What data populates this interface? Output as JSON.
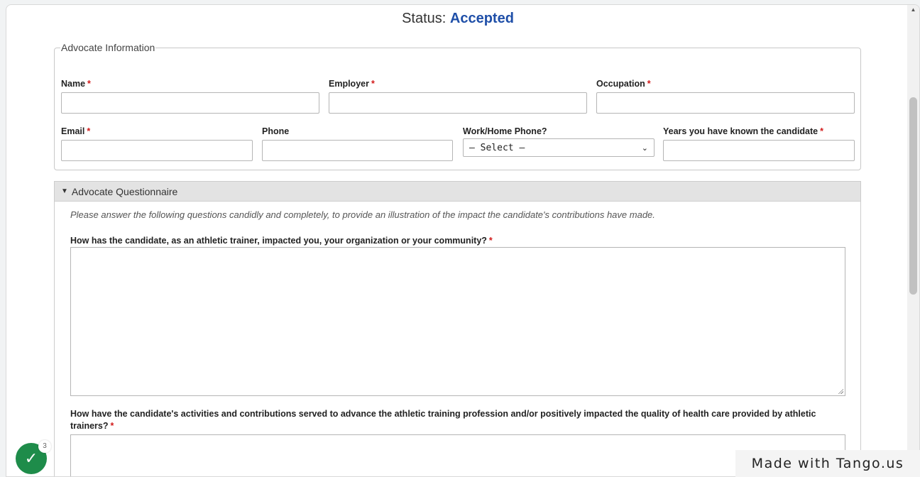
{
  "status": {
    "label": "Status:",
    "value": "Accepted"
  },
  "advocate_info": {
    "legend": "Advocate Information",
    "fields": {
      "name": {
        "label": "Name",
        "required": "*",
        "value": ""
      },
      "employer": {
        "label": "Employer",
        "required": "*",
        "value": ""
      },
      "occupation": {
        "label": "Occupation",
        "required": "*",
        "value": ""
      },
      "email": {
        "label": "Email",
        "required": "*",
        "value": ""
      },
      "phone": {
        "label": "Phone",
        "value": ""
      },
      "work_home": {
        "label": "Work/Home Phone?",
        "selected": "– Select –"
      },
      "years": {
        "label": "Years you have known the candidate",
        "required": "*",
        "value": ""
      }
    }
  },
  "questionnaire": {
    "title": "Advocate Questionnaire",
    "intro": "Please answer the following questions candidly and completely, to provide an illustration of the impact the candidate's contributions have made.",
    "q1": {
      "text": "How has the candidate, as an athletic trainer, impacted you, your organization or your community?",
      "required": "*"
    },
    "q2": {
      "text": "How have the candidate's activities and contributions served to advance the athletic training profession and/or positively impacted the quality of health care provided by athletic trainers?",
      "required": "*"
    }
  },
  "badge": {
    "count": "3"
  },
  "watermark": "Made with Tango.us"
}
